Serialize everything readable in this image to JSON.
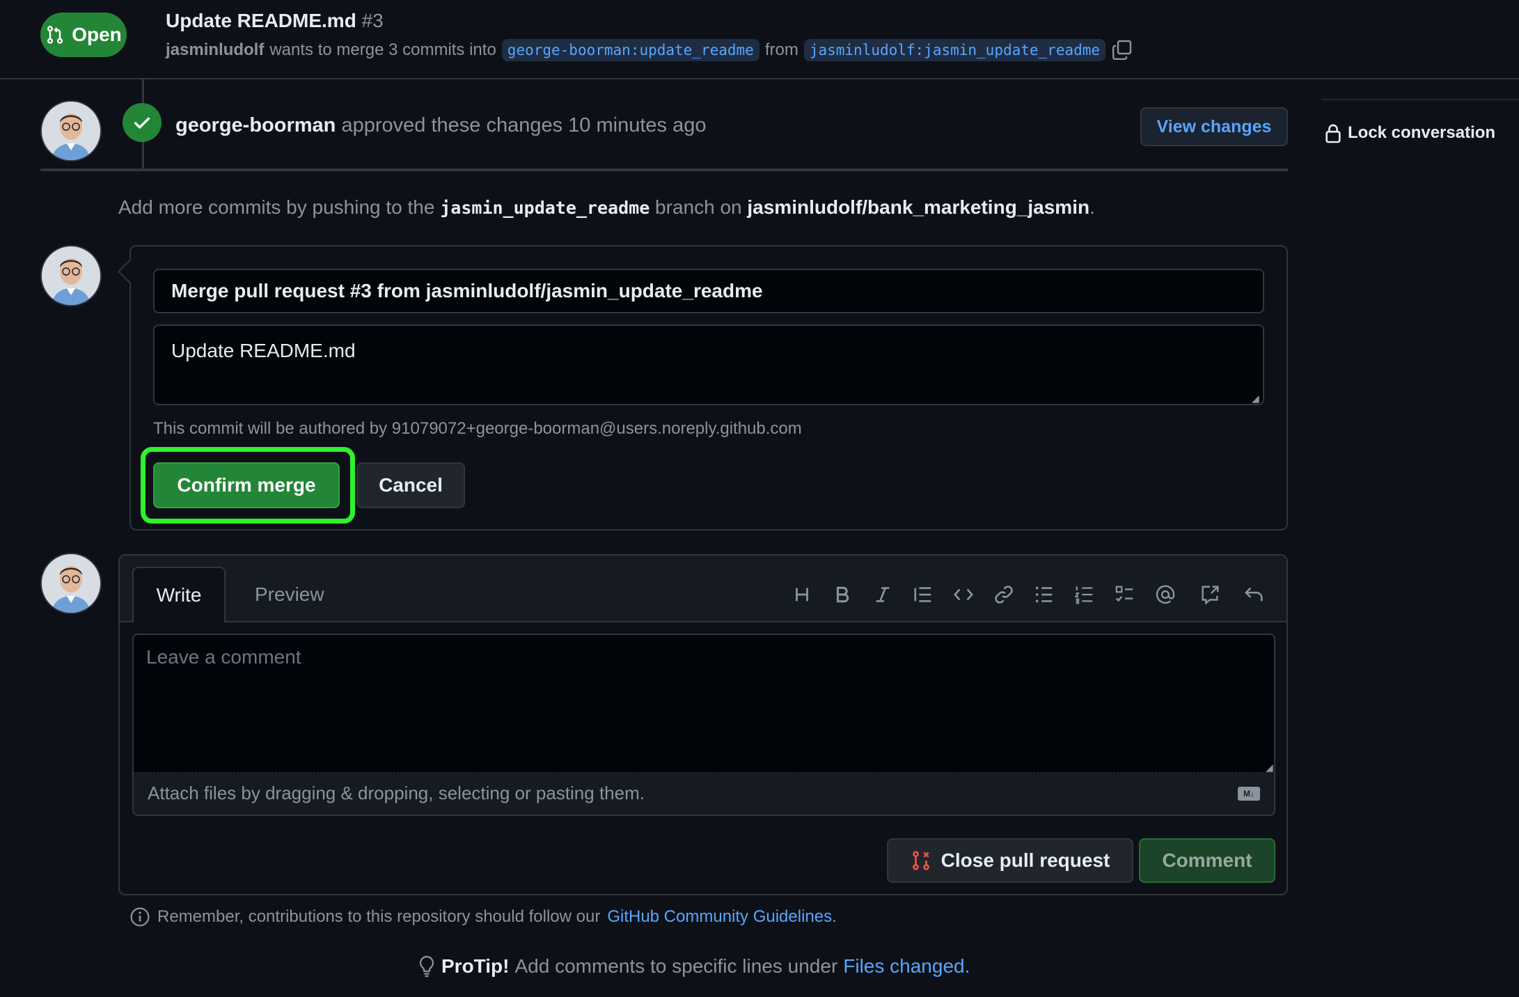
{
  "header": {
    "state": "Open",
    "title": "Update README.md",
    "number": "#3",
    "author": "jasminludolf",
    "merge_text": "wants to merge 3 commits into",
    "base_branch": "george-boorman:update_readme",
    "from_text": "from",
    "head_branch": "jasminludolf:jasmin_update_readme"
  },
  "approval": {
    "reviewer": "george-boorman",
    "text": "approved these changes 10 minutes ago",
    "view_changes_label": "View changes"
  },
  "sidebar": {
    "lock_label": "Lock conversation"
  },
  "push_hint": {
    "prefix": "Add more commits by pushing to the",
    "branch": "jasmin_update_readme",
    "middle": "branch on",
    "repo": "jasminludolf/bank_marketing_jasmin",
    "suffix": "."
  },
  "merge": {
    "title_value": "Merge pull request #3 from jasminludolf/jasmin_update_readme",
    "body_value": "Update README.md",
    "author_note": "This commit will be authored by 91079072+george-boorman@users.noreply.github.com",
    "confirm_label": "Confirm merge",
    "cancel_label": "Cancel"
  },
  "comment": {
    "tab_write": "Write",
    "tab_preview": "Preview",
    "placeholder": "Leave a comment",
    "attach_text": "Attach files by dragging & dropping, selecting or pasting them.",
    "markdown_badge": "M↓",
    "close_label": "Close pull request",
    "comment_label": "Comment",
    "toolbar_icons": [
      "heading-icon",
      "bold-icon",
      "italic-icon",
      "quote-icon",
      "code-icon",
      "link-icon",
      "unordered-list-icon",
      "ordered-list-icon",
      "task-list-icon",
      "mention-icon",
      "reference-icon",
      "undo-icon"
    ]
  },
  "footer": {
    "remember_text": "Remember, contributions to this repository should follow our",
    "guidelines_link": "GitHub Community Guidelines",
    "remember_suffix": ".",
    "protip_label": "ProTip!",
    "protip_text": "Add comments to specific lines under",
    "protip_link": "Files changed",
    "protip_suffix": "."
  },
  "colors": {
    "background": "#0d1117",
    "accent_green": "#238636",
    "link_blue": "#58a6ff",
    "highlight": "#2df22d"
  }
}
